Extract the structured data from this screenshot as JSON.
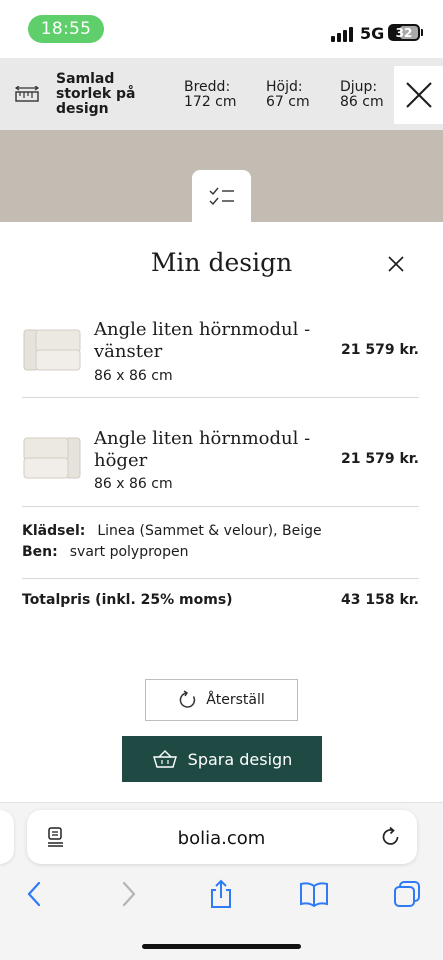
{
  "status": {
    "time": "18:55",
    "network": "5G",
    "battery": "32"
  },
  "size_bar": {
    "title": "Samlad storlek på design",
    "width_label": "Bredd:",
    "width_value": "172 cm",
    "height_label": "Höjd:",
    "height_value": "67 cm",
    "depth_label": "Djup:",
    "depth_value": "86 cm",
    "icons": {
      "ruler": "ruler-icon",
      "close": "close-icon",
      "checklist": "checklist-icon"
    }
  },
  "panel": {
    "title": "Min design",
    "items": [
      {
        "name": "Angle liten hörnmodul - vänster",
        "size": "86 x 86 cm",
        "price": "21 579 kr."
      },
      {
        "name": "Angle liten hörnmodul - höger",
        "size": "86 x 86 cm",
        "price": "21 579 kr."
      }
    ],
    "specs": [
      {
        "label": "Klädsel:",
        "value": "Linea (Sammet & velour), Beige"
      },
      {
        "label": "Ben:",
        "value": "svart polypropen"
      }
    ],
    "total_label": "Totalpris (inkl. 25% moms)",
    "total_value": "43 158 kr.",
    "reset_label": "Återställ",
    "save_label": "Spara design"
  },
  "browser": {
    "url": "bolia.com",
    "icons": [
      "back-icon",
      "forward-icon",
      "share-icon",
      "bookmarks-icon",
      "tabs-icon"
    ]
  },
  "colors": {
    "accent": "#1f4a43",
    "backdrop": "#c2bcb3",
    "status_pill": "#5fcf6b",
    "ios_blue": "#2f7bf6"
  }
}
